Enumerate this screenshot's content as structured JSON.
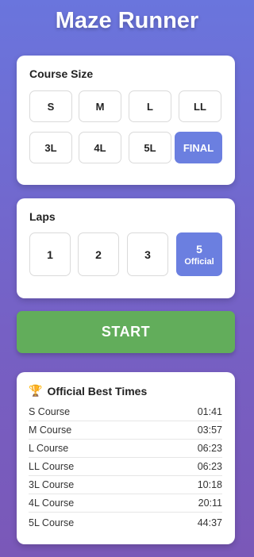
{
  "app": {
    "title": "Maze Runner"
  },
  "course_size": {
    "heading": "Course Size",
    "options": [
      "S",
      "M",
      "L",
      "LL",
      "3L",
      "4L",
      "5L",
      "FINAL"
    ],
    "selected": "FINAL"
  },
  "laps": {
    "heading": "Laps",
    "options": [
      {
        "label": "1",
        "sub": ""
      },
      {
        "label": "2",
        "sub": ""
      },
      {
        "label": "3",
        "sub": ""
      },
      {
        "label": "5",
        "sub": "Official"
      }
    ],
    "selected": "5"
  },
  "start_button": {
    "label": "START"
  },
  "best_times": {
    "icon": "trophy-icon",
    "heading": "Official Best Times",
    "rows": [
      {
        "course": "S Course",
        "time": "01:41"
      },
      {
        "course": "M Course",
        "time": "03:57"
      },
      {
        "course": "L Course",
        "time": "06:23"
      },
      {
        "course": "LL Course",
        "time": "06:23"
      },
      {
        "course": "3L Course",
        "time": "10:18"
      },
      {
        "course": "4L Course",
        "time": "20:11"
      },
      {
        "course": "5L Course",
        "time": "44:37"
      }
    ]
  },
  "colors": {
    "accent": "#6b7fe0",
    "start": "#62ad5b",
    "background_top": "#6a75dd",
    "background_bottom": "#7a58b8"
  }
}
